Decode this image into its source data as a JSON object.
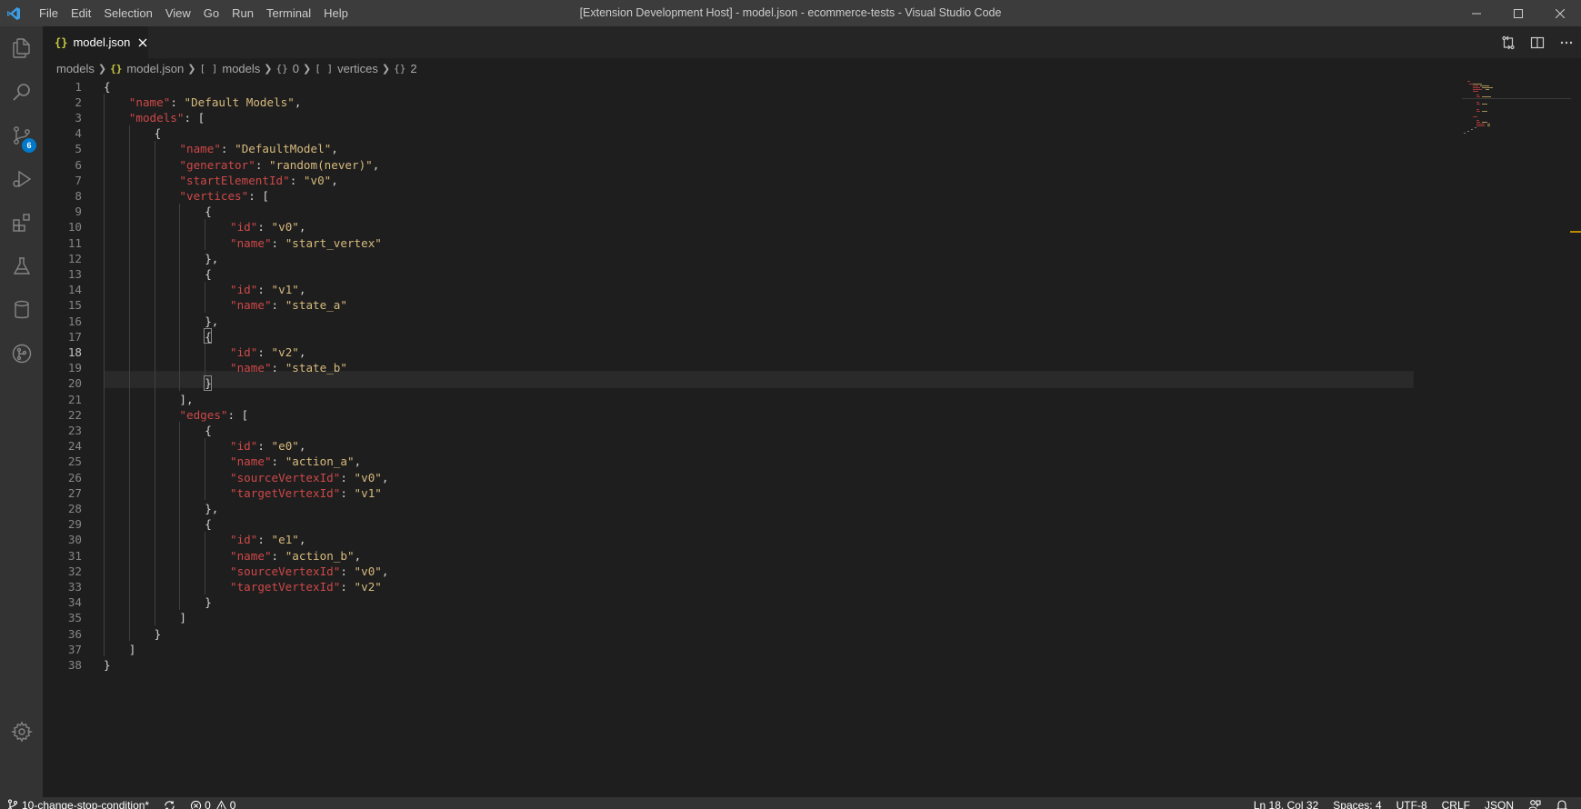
{
  "window": {
    "title": "[Extension Development Host] - model.json - ecommerce-tests - Visual Studio Code"
  },
  "menu": [
    "File",
    "Edit",
    "Selection",
    "View",
    "Go",
    "Run",
    "Terminal",
    "Help"
  ],
  "activity_bar": {
    "items": [
      "explorer-icon",
      "search-icon",
      "source-control-icon",
      "run-debug-icon",
      "extensions-icon",
      "testing-icon",
      "database-icon",
      "git-graph-icon"
    ],
    "source_control_badge": "6",
    "bottom": "settings-gear-icon"
  },
  "tab": {
    "icon": "{}",
    "label": "model.json"
  },
  "breadcrumbs": [
    {
      "icon": "",
      "label": "models"
    },
    {
      "icon": "{}",
      "label": "model.json"
    },
    {
      "icon": "[ ]",
      "label": "models"
    },
    {
      "icon": "{}",
      "label": "0"
    },
    {
      "icon": "[ ]",
      "label": "vertices"
    },
    {
      "icon": "{}",
      "label": "2"
    }
  ],
  "editor": {
    "active_line": 18,
    "lines": [
      {
        "n": "1",
        "indent": 0,
        "tokens": [
          [
            "p",
            "{"
          ]
        ]
      },
      {
        "n": "2",
        "indent": 1,
        "tokens": [
          [
            "k",
            "name"
          ],
          [
            "p",
            ": "
          ],
          [
            "s",
            "Default Models"
          ],
          [
            "p",
            ","
          ]
        ]
      },
      {
        "n": "3",
        "indent": 1,
        "tokens": [
          [
            "k",
            "models"
          ],
          [
            "p",
            ": ["
          ]
        ]
      },
      {
        "n": "4",
        "indent": 2,
        "tokens": [
          [
            "p",
            "{"
          ]
        ]
      },
      {
        "n": "5",
        "indent": 3,
        "tokens": [
          [
            "k",
            "name"
          ],
          [
            "p",
            ": "
          ],
          [
            "s",
            "DefaultModel"
          ],
          [
            "p",
            ","
          ]
        ]
      },
      {
        "n": "6",
        "indent": 3,
        "tokens": [
          [
            "k",
            "generator"
          ],
          [
            "p",
            ": "
          ],
          [
            "s",
            "random(never)"
          ],
          [
            "p",
            ","
          ]
        ]
      },
      {
        "n": "7",
        "indent": 3,
        "tokens": [
          [
            "k",
            "startElementId"
          ],
          [
            "p",
            ": "
          ],
          [
            "s",
            "v0"
          ],
          [
            "p",
            ","
          ]
        ]
      },
      {
        "n": "8",
        "indent": 3,
        "tokens": [
          [
            "k",
            "vertices"
          ],
          [
            "p",
            ": ["
          ]
        ]
      },
      {
        "n": "9",
        "indent": 4,
        "tokens": [
          [
            "p",
            "{"
          ]
        ]
      },
      {
        "n": "10",
        "indent": 5,
        "tokens": [
          [
            "k",
            "id"
          ],
          [
            "p",
            ": "
          ],
          [
            "s",
            "v0"
          ],
          [
            "p",
            ","
          ]
        ]
      },
      {
        "n": "11",
        "indent": 5,
        "tokens": [
          [
            "k",
            "name"
          ],
          [
            "p",
            ": "
          ],
          [
            "s",
            "start_vertex"
          ]
        ]
      },
      {
        "n": "12",
        "indent": 4,
        "tokens": [
          [
            "p",
            "},"
          ]
        ]
      },
      {
        "n": "13",
        "indent": 4,
        "tokens": [
          [
            "p",
            "{"
          ]
        ]
      },
      {
        "n": "14",
        "indent": 5,
        "tokens": [
          [
            "k",
            "id"
          ],
          [
            "p",
            ": "
          ],
          [
            "s",
            "v1"
          ],
          [
            "p",
            ","
          ]
        ]
      },
      {
        "n": "15",
        "indent": 5,
        "tokens": [
          [
            "k",
            "name"
          ],
          [
            "p",
            ": "
          ],
          [
            "s",
            "state_a"
          ]
        ]
      },
      {
        "n": "16",
        "indent": 4,
        "tokens": [
          [
            "p",
            "},"
          ]
        ]
      },
      {
        "n": "17",
        "indent": 4,
        "tokens": [
          [
            "p",
            "{"
          ]
        ]
      },
      {
        "n": "18",
        "indent": 5,
        "tokens": [
          [
            "k",
            "id"
          ],
          [
            "p",
            ": "
          ],
          [
            "s",
            "v2"
          ],
          [
            "p",
            ","
          ]
        ]
      },
      {
        "n": "19",
        "indent": 5,
        "tokens": [
          [
            "k",
            "name"
          ],
          [
            "p",
            ": "
          ],
          [
            "s",
            "state_b"
          ]
        ]
      },
      {
        "n": "20",
        "indent": 4,
        "tokens": [
          [
            "p",
            "}"
          ]
        ]
      },
      {
        "n": "21",
        "indent": 3,
        "tokens": [
          [
            "p",
            "],"
          ]
        ]
      },
      {
        "n": "22",
        "indent": 3,
        "tokens": [
          [
            "k",
            "edges"
          ],
          [
            "p",
            ": ["
          ]
        ]
      },
      {
        "n": "23",
        "indent": 4,
        "tokens": [
          [
            "p",
            "{"
          ]
        ]
      },
      {
        "n": "24",
        "indent": 5,
        "tokens": [
          [
            "k",
            "id"
          ],
          [
            "p",
            ": "
          ],
          [
            "s",
            "e0"
          ],
          [
            "p",
            ","
          ]
        ]
      },
      {
        "n": "25",
        "indent": 5,
        "tokens": [
          [
            "k",
            "name"
          ],
          [
            "p",
            ": "
          ],
          [
            "s",
            "action_a"
          ],
          [
            "p",
            ","
          ]
        ]
      },
      {
        "n": "26",
        "indent": 5,
        "tokens": [
          [
            "k",
            "sourceVertexId"
          ],
          [
            "p",
            ": "
          ],
          [
            "s",
            "v0"
          ],
          [
            "p",
            ","
          ]
        ]
      },
      {
        "n": "27",
        "indent": 5,
        "tokens": [
          [
            "k",
            "targetVertexId"
          ],
          [
            "p",
            ": "
          ],
          [
            "s",
            "v1"
          ]
        ]
      },
      {
        "n": "28",
        "indent": 4,
        "tokens": [
          [
            "p",
            "},"
          ]
        ]
      },
      {
        "n": "29",
        "indent": 4,
        "tokens": [
          [
            "p",
            "{"
          ]
        ]
      },
      {
        "n": "30",
        "indent": 5,
        "tokens": [
          [
            "k",
            "id"
          ],
          [
            "p",
            ": "
          ],
          [
            "s",
            "e1"
          ],
          [
            "p",
            ","
          ]
        ]
      },
      {
        "n": "31",
        "indent": 5,
        "tokens": [
          [
            "k",
            "name"
          ],
          [
            "p",
            ": "
          ],
          [
            "s",
            "action_b"
          ],
          [
            "p",
            ","
          ]
        ]
      },
      {
        "n": "32",
        "indent": 5,
        "tokens": [
          [
            "k",
            "sourceVertexId"
          ],
          [
            "p",
            ": "
          ],
          [
            "s",
            "v0"
          ],
          [
            "p",
            ","
          ]
        ]
      },
      {
        "n": "33",
        "indent": 5,
        "tokens": [
          [
            "k",
            "targetVertexId"
          ],
          [
            "p",
            ": "
          ],
          [
            "s",
            "v2"
          ]
        ]
      },
      {
        "n": "34",
        "indent": 4,
        "tokens": [
          [
            "p",
            "}"
          ]
        ]
      },
      {
        "n": "35",
        "indent": 3,
        "tokens": [
          [
            "p",
            "]"
          ]
        ]
      },
      {
        "n": "36",
        "indent": 2,
        "tokens": [
          [
            "p",
            "}"
          ]
        ]
      },
      {
        "n": "37",
        "indent": 1,
        "tokens": [
          [
            "p",
            "]"
          ]
        ]
      },
      {
        "n": "38",
        "indent": 0,
        "tokens": [
          [
            "p",
            "}"
          ]
        ]
      }
    ]
  },
  "status_bar": {
    "branch": "10-change-stop-condition*",
    "errors": "0",
    "warnings": "0",
    "cursor": "Ln 18, Col 32",
    "spaces": "Spaces: 4",
    "encoding": "UTF-8",
    "eol": "CRLF",
    "language": "JSON"
  },
  "colors": {
    "accent": "#007acc",
    "json_key": "#ce4848",
    "json_string": "#d7ba7d",
    "overview_marker": "#bf8803"
  }
}
